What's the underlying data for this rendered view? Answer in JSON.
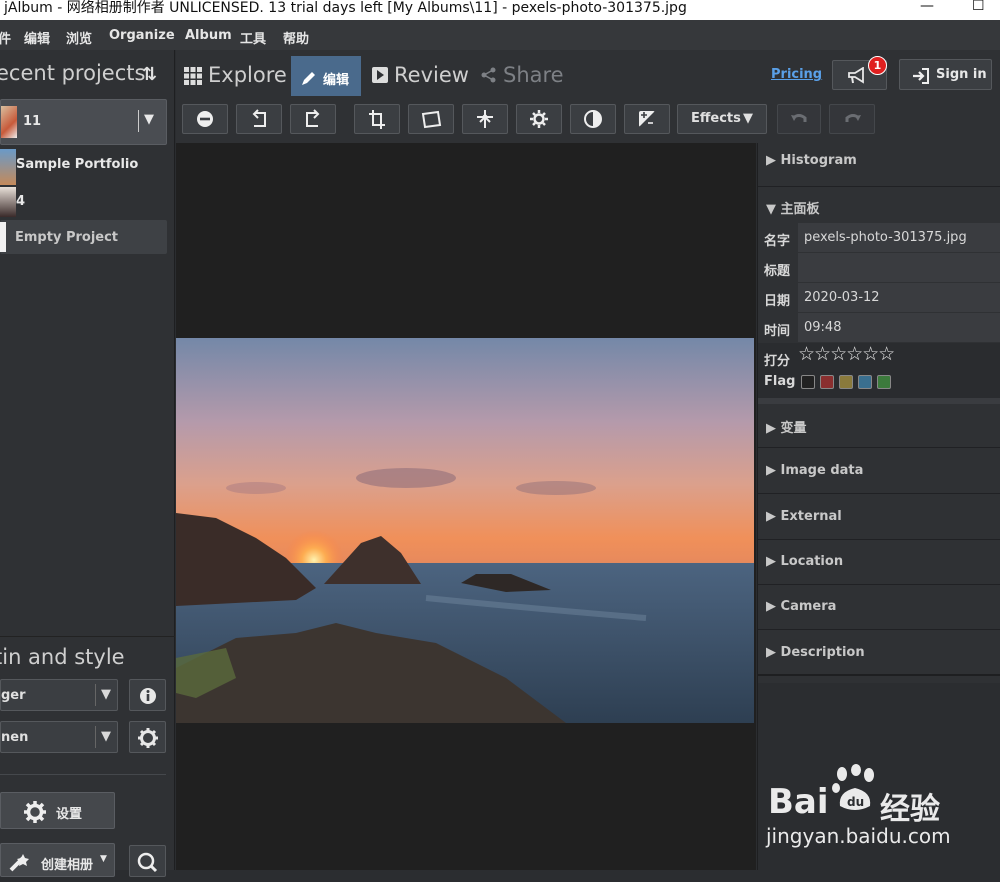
{
  "window": {
    "title": "jAlbum - 网络相册制作者 UNLICENSED. 13 trial days left [My Albums\\11] - pexels-photo-301375.jpg",
    "minimize_glyph": "—",
    "maximize_glyph": "☐"
  },
  "menu": [
    "件",
    "编辑",
    "浏览",
    "Organize",
    "Album",
    "工具",
    "帮助"
  ],
  "left": {
    "recent_projects_title": "ecent projects",
    "sort_glyph": "⇅",
    "selected_project": "11",
    "projects": [
      "Sample Portfolio",
      "4",
      "Empty Project"
    ],
    "skin_title": "tin and style",
    "skin_select": "ger",
    "style_select": "nen",
    "dropdown_glyph": "▼",
    "settings_button": "设置",
    "create_album_button": "创建相册"
  },
  "tabs": {
    "explore": "Explore",
    "edit": "编辑",
    "review": "Review",
    "share": "Share"
  },
  "header_right": {
    "pricing": "Pricing",
    "notification_count": "1",
    "sign_in": "Sign in"
  },
  "edit_toolbar": {
    "effects_label": "Effects",
    "effects_glyph": "▼",
    "icons": [
      "minus-circle-icon",
      "rotate-left-icon",
      "rotate-right-icon",
      "crop-icon",
      "straighten-icon",
      "focus-point-icon",
      "gear-icon",
      "contrast-icon",
      "exposure-icon",
      "undo-icon",
      "redo-icon"
    ]
  },
  "right_panel": {
    "histogram": "▶ Histogram",
    "main_panel": "▼ 主面板",
    "name_label": "名字",
    "name_value": "pexels-photo-301375.jpg",
    "title_label": "标题",
    "title_value": "",
    "date_label": "日期",
    "date_value": "2020-03-12",
    "time_label": "时间",
    "time_value": "09:48",
    "rating_label": "打分",
    "rating_stars": "☆☆☆☆☆☆",
    "rating_value": 0,
    "flag_label": "Flag",
    "flag_colors": [
      "#222222",
      "#8a2f2f",
      "#8a7a3c",
      "#3a6f8f",
      "#3c7a3c"
    ],
    "sections": [
      "▶ 变量",
      "▶ Image data",
      "▶ External",
      "▶ Location",
      "▶ Camera",
      "▶ Description"
    ]
  },
  "watermark": {
    "brand": "Bai",
    "brand2": "经验",
    "url": "jingyan.baidu.com"
  },
  "colors": {
    "accent_tab": "#4a6a8c",
    "pricing_link": "#5aa0e8",
    "badge": "#e02020"
  }
}
